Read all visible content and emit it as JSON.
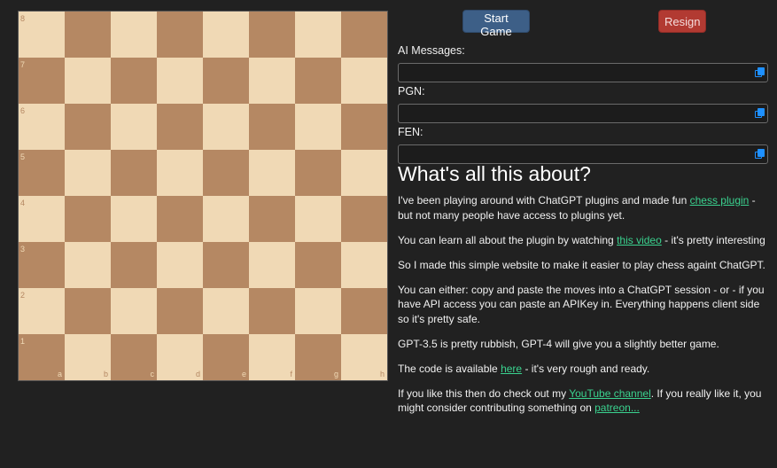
{
  "board": {
    "ranks": [
      "8",
      "7",
      "6",
      "5",
      "4",
      "3",
      "2",
      "1"
    ],
    "files": [
      "a",
      "b",
      "c",
      "d",
      "e",
      "f",
      "g",
      "h"
    ],
    "light_color": "#f0d9b5",
    "dark_color": "#b58863"
  },
  "controls": {
    "start_label": "Start Game",
    "resign_label": "Resign"
  },
  "fields": {
    "ai_messages_label": "AI Messages:",
    "ai_messages_value": "",
    "pgn_label": "PGN:",
    "pgn_value": "",
    "fen_label": "FEN:",
    "fen_value": "",
    "copy_icon": "copy-icon"
  },
  "about": {
    "heading": "What's all this about?",
    "p1_a": "I've been playing around with ChatGPT plugins and made fun ",
    "p1_link": "chess plugin",
    "p1_b": " - but not many people have access to plugins yet.",
    "p2_a": "You can learn all about the plugin by watching ",
    "p2_link": "this video",
    "p2_b": " - it's pretty interesting",
    "p3": "So I made this simple website to make it easier to play chess againt ChatGPT.",
    "p4": "You can either: copy and paste the moves into a ChatGPT session - or - if you have API access you can paste an APIKey in. Everything happens client side so it's pretty safe.",
    "p5": "GPT-3.5 is pretty rubbish, GPT-4 will give you a slightly better game.",
    "p6_a": "The code is available ",
    "p6_link": "here",
    "p6_b": " - it's very rough and ready.",
    "p7_a": "If you like this then do check out my ",
    "p7_link1": "YouTube channel",
    "p7_b": ". If you really like it, you might consider contributing something on ",
    "p7_link2": "patreon..."
  },
  "colors": {
    "background": "#212121",
    "link": "#3ad28f",
    "start_button": "#3d5f87",
    "resign_button": "#b23a32"
  }
}
